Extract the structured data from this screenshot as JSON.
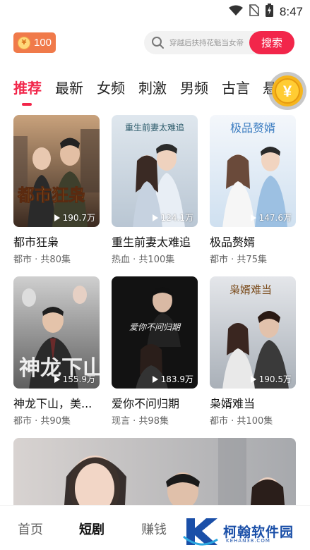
{
  "status_bar": {
    "time": "8:47",
    "icons": [
      "wifi-icon",
      "no-sim-icon",
      "battery-charging-icon"
    ]
  },
  "header": {
    "coin_count": "100",
    "coin_symbol": "¥",
    "search_placeholder": "穿越后扶持花魁当女帝",
    "search_button": "搜索"
  },
  "tabs": [
    {
      "label": "推荐",
      "active": true
    },
    {
      "label": "最新"
    },
    {
      "label": "女频"
    },
    {
      "label": "刺激"
    },
    {
      "label": "男频"
    },
    {
      "label": "古言"
    },
    {
      "label": "悬"
    }
  ],
  "floating_reward": {
    "symbol": "¥",
    "icon": "gold-coin-icon"
  },
  "dramas": [
    {
      "title": "都市狂枭",
      "genre": "都市",
      "episodes": "共80集",
      "views": "190.7万",
      "poster_text": "都市狂枭"
    },
    {
      "title": "重生前妻太难追",
      "genre": "热血",
      "episodes": "共100集",
      "views": "124.1万",
      "poster_text": "重生前妻太难追"
    },
    {
      "title": "极品赘婿",
      "genre": "都市",
      "episodes": "共75集",
      "views": "147.6万",
      "poster_text": "极品赘婿"
    },
    {
      "title": "神龙下山，美...",
      "genre": "都市",
      "episodes": "共90集",
      "views": "155.9万",
      "poster_text": "神龙下山"
    },
    {
      "title": "爱你不问归期",
      "genre": "现言",
      "episodes": "共98集",
      "views": "183.9万",
      "poster_text": "爱你不问归期"
    },
    {
      "title": "枭婿难当",
      "genre": "都市",
      "episodes": "共100集",
      "views": "190.5万",
      "poster_text": "枭婿难当"
    }
  ],
  "meta_separator": " · ",
  "bottom_nav": [
    {
      "label": "首页"
    },
    {
      "label": "短剧",
      "active": true
    },
    {
      "label": "赚钱"
    }
  ],
  "watermark": {
    "text": "柯翰软件园",
    "sub": "KEHAN38.COM"
  },
  "colors": {
    "accent": "#f2264a",
    "coin_badge": "#f07a4a",
    "watermark": "#1a4fa8"
  }
}
